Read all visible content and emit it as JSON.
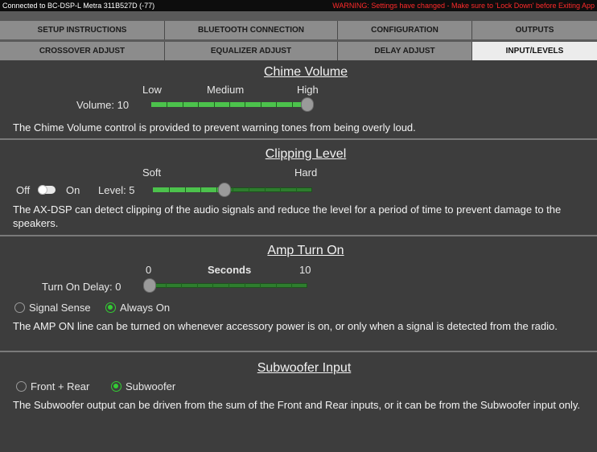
{
  "status": {
    "connection": "Connected to BC-DSP-L Metra 311B527D (-77)",
    "warning": "WARNING: Settings have changed - Make sure to 'Lock Down' before Exiting App"
  },
  "tabs_row1": [
    "SETUP INSTRUCTIONS",
    "BLUETOOTH CONNECTION",
    "CONFIGURATION",
    "OUTPUTS"
  ],
  "tabs_row2": [
    "CROSSOVER ADJUST",
    "EQUALIZER ADJUST",
    "DELAY ADJUST",
    "INPUT/LEVELS"
  ],
  "active_tab": "INPUT/LEVELS",
  "chime": {
    "title": "Chime Volume",
    "low": "Low",
    "medium": "Medium",
    "high": "High",
    "volume_label": "Volume: 10",
    "level_fraction": 1.0,
    "description": "The Chime Volume control is provided to prevent warning tones from being overly loud."
  },
  "clipping": {
    "title": "Clipping Level",
    "soft": "Soft",
    "hard": "Hard",
    "off": "Off",
    "on": "On",
    "level_label": "Level:  5",
    "level_fraction": 0.45,
    "description": "The AX-DSP can detect clipping of the audio signals and reduce the level for a period of time to prevent damage to the speakers."
  },
  "amp": {
    "title": "Amp Turn On",
    "zero": "0",
    "seconds": "Seconds",
    "ten": "10",
    "delay_label": "Turn On Delay:  0",
    "level_fraction": 0.0,
    "option1": "Signal Sense",
    "option2": "Always On",
    "selected": "Always On",
    "description": "The AMP ON line can be turned on whenever accessory power is on, or only when a signal is detected from the radio."
  },
  "sub": {
    "title": "Subwoofer Input",
    "option1": "Front + Rear",
    "option2": "Subwoofer",
    "selected": "Subwoofer",
    "description": "The Subwoofer output can be driven from the sum of the Front and Rear inputs, or it can be from the Subwoofer input only."
  },
  "colors": {
    "accent_green": "#33cc33",
    "warning_red": "#ff2a2a",
    "panel": "#3d3d3d"
  }
}
